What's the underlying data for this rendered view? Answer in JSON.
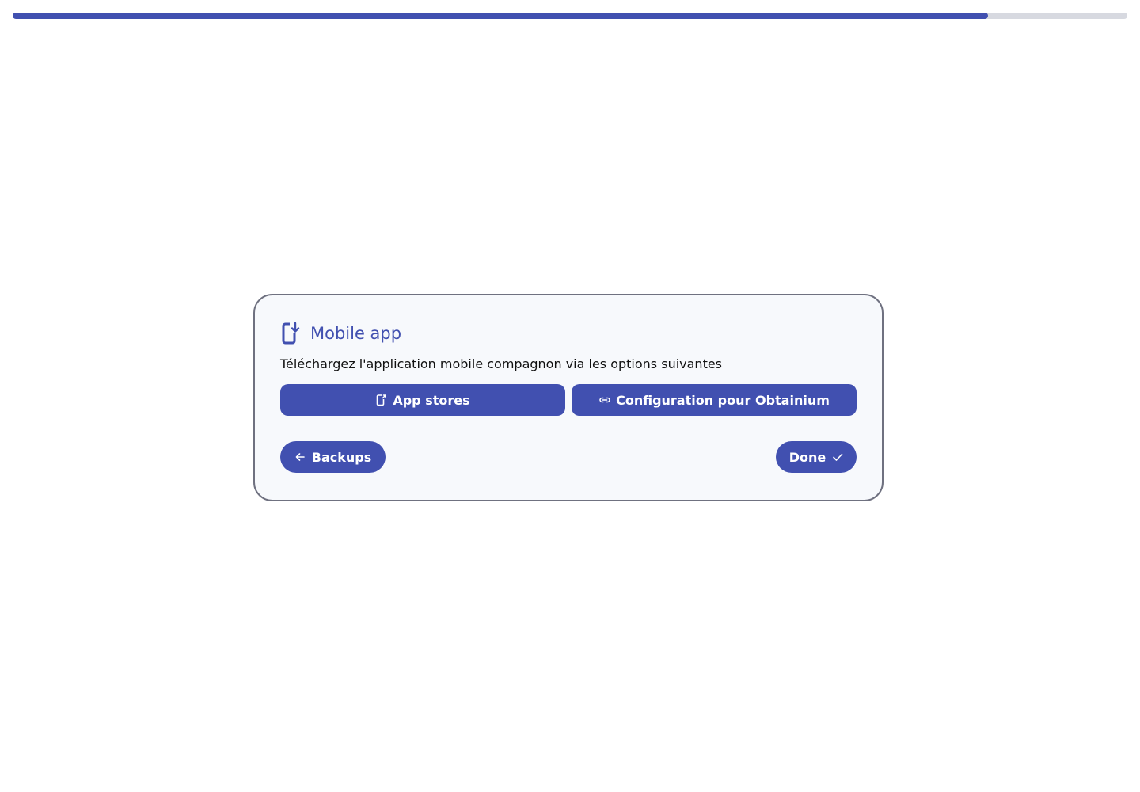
{
  "progress": {
    "fraction": 0.875,
    "fill_color": "#4150b0",
    "track_color": "#d7d9e0"
  },
  "card": {
    "icon": "phone-download-icon",
    "title": "Mobile app",
    "description": "Téléchargez l'application mobile compagnon via les options suivantes",
    "actions": {
      "app_stores": {
        "label": "App stores",
        "icon": "phone-external-icon"
      },
      "obtainium": {
        "label": "Configuration pour Obtainium",
        "icon": "link-icon"
      }
    }
  },
  "navigation": {
    "back": {
      "label": "Backups",
      "icon": "arrow-left-icon"
    },
    "done": {
      "label": "Done",
      "icon": "check-icon"
    }
  },
  "colors": {
    "accent": "#4150b0",
    "card_background": "#f7f9fc",
    "card_border": "#6f7180"
  }
}
